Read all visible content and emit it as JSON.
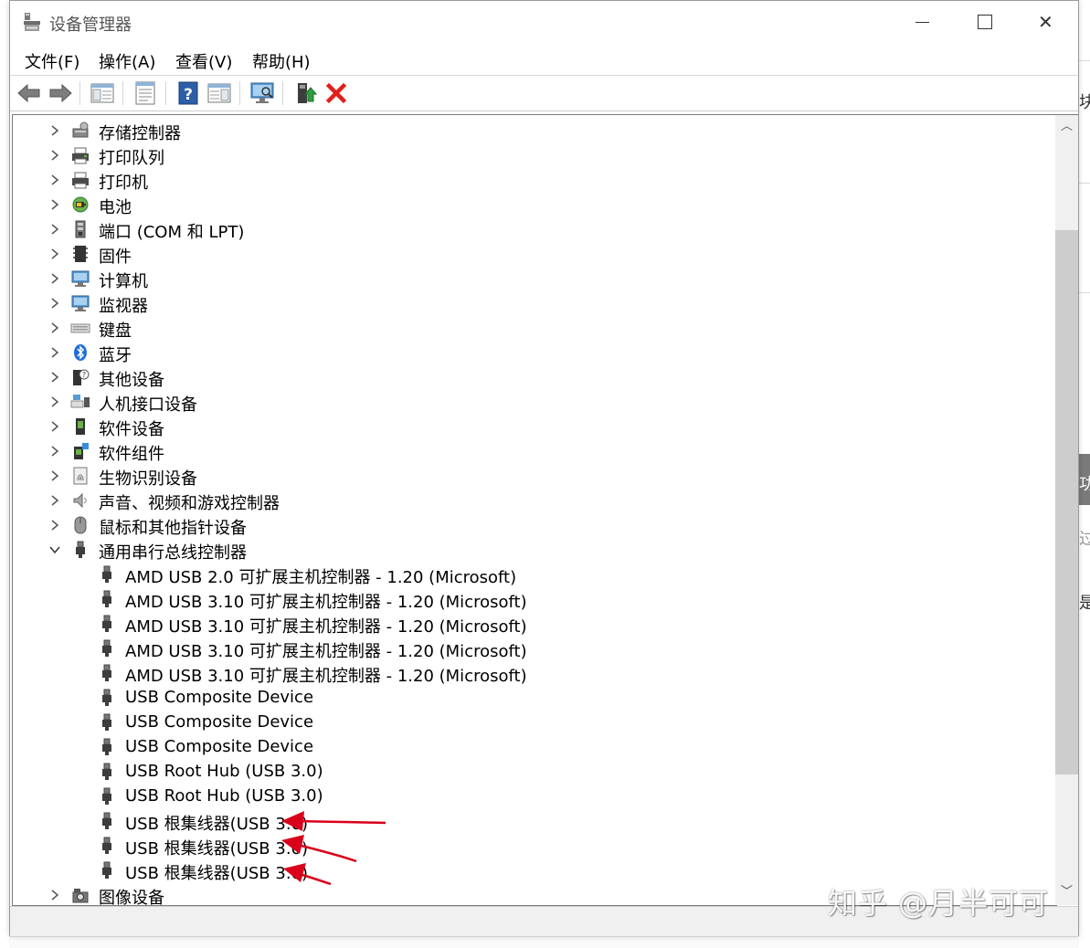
{
  "window": {
    "title": "设备管理器"
  },
  "menu": [
    {
      "label": "文件(F)"
    },
    {
      "label": "操作(A)"
    },
    {
      "label": "查看(V)"
    },
    {
      "label": "帮助(H)"
    }
  ],
  "toolbar": [
    {
      "icon": "back-arrow-icon"
    },
    {
      "icon": "forward-arrow-icon"
    },
    {
      "icon": "show-hide-console-tree-icon"
    },
    {
      "icon": "properties-icon"
    },
    {
      "icon": "help-icon"
    },
    {
      "icon": "action-pane-icon"
    },
    {
      "icon": "scan-hardware-icon"
    },
    {
      "icon": "update-driver-icon"
    },
    {
      "icon": "uninstall-device-icon"
    }
  ],
  "tree": {
    "categories": [
      {
        "label": "存储控制器",
        "icon": "storage-controller-icon",
        "expanded": false
      },
      {
        "label": "打印队列",
        "icon": "print-queue-icon",
        "expanded": false
      },
      {
        "label": "打印机",
        "icon": "printer-icon",
        "expanded": false
      },
      {
        "label": "电池",
        "icon": "battery-icon",
        "expanded": false
      },
      {
        "label": "端口 (COM 和 LPT)",
        "icon": "port-icon",
        "expanded": false
      },
      {
        "label": "固件",
        "icon": "firmware-icon",
        "expanded": false
      },
      {
        "label": "计算机",
        "icon": "computer-icon",
        "expanded": false
      },
      {
        "label": "监视器",
        "icon": "monitor-icon",
        "expanded": false
      },
      {
        "label": "键盘",
        "icon": "keyboard-icon",
        "expanded": false
      },
      {
        "label": "蓝牙",
        "icon": "bluetooth-icon",
        "expanded": false
      },
      {
        "label": "其他设备",
        "icon": "other-devices-icon",
        "expanded": false
      },
      {
        "label": "人机接口设备",
        "icon": "hid-icon",
        "expanded": false
      },
      {
        "label": "软件设备",
        "icon": "software-device-icon",
        "expanded": false
      },
      {
        "label": "软件组件",
        "icon": "software-component-icon",
        "expanded": false
      },
      {
        "label": "生物识别设备",
        "icon": "biometric-icon",
        "expanded": false
      },
      {
        "label": "声音、视频和游戏控制器",
        "icon": "sound-icon",
        "expanded": false
      },
      {
        "label": "鼠标和其他指针设备",
        "icon": "mouse-icon",
        "expanded": false
      },
      {
        "label": "通用串行总线控制器",
        "icon": "usb-icon",
        "expanded": true
      }
    ],
    "usb_children": [
      {
        "label": "AMD USB 2.0 可扩展主机控制器 - 1.20 (Microsoft)"
      },
      {
        "label": "AMD USB 3.10 可扩展主机控制器 - 1.20 (Microsoft)"
      },
      {
        "label": "AMD USB 3.10 可扩展主机控制器 - 1.20 (Microsoft)"
      },
      {
        "label": "AMD USB 3.10 可扩展主机控制器 - 1.20 (Microsoft)"
      },
      {
        "label": "AMD USB 3.10 可扩展主机控制器 - 1.20 (Microsoft)"
      },
      {
        "label": "USB Composite Device"
      },
      {
        "label": "USB Composite Device"
      },
      {
        "label": "USB Composite Device"
      },
      {
        "label": "USB Root Hub (USB 3.0)"
      },
      {
        "label": "USB Root Hub (USB 3.0)"
      },
      {
        "label": "USB 根集线器(USB 3.0)"
      },
      {
        "label": "USB 根集线器(USB 3.0)"
      },
      {
        "label": "USB 根集线器(USB 3.0)"
      }
    ],
    "after": [
      {
        "label": "图像设备",
        "icon": "imaging-device-icon",
        "expanded": false
      }
    ]
  },
  "watermark": "知乎 @月半可可",
  "background": {
    "right_chars": [
      "块",
      "功",
      "过",
      "是"
    ]
  },
  "colors": {
    "annotation_arrow": "#d9001b",
    "uninstall_red": "#e0201b"
  }
}
